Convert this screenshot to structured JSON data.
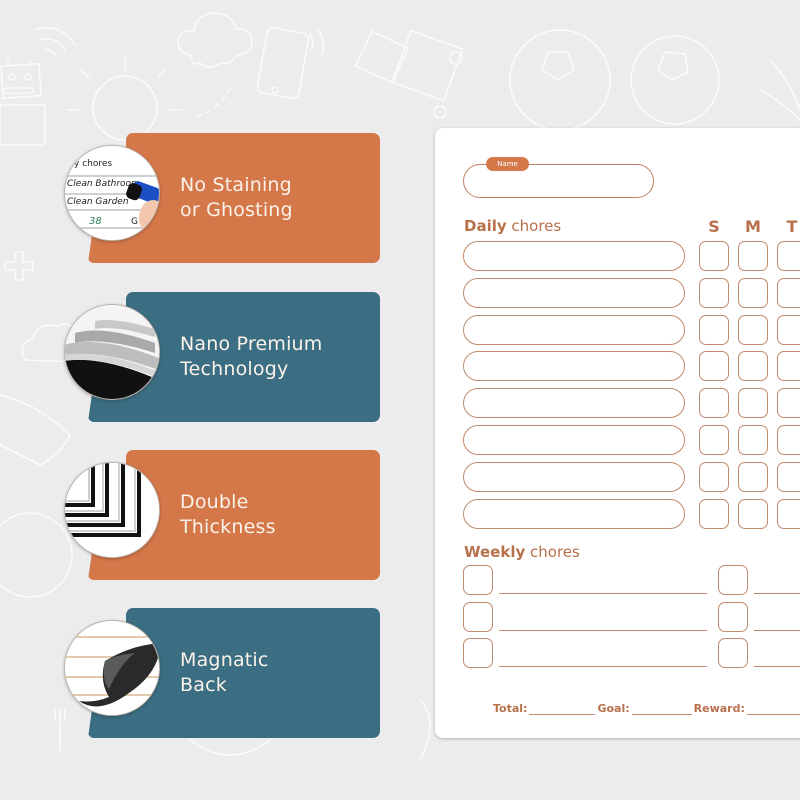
{
  "features": [
    {
      "line1": "No Staining",
      "line2": "or Ghosting",
      "theme": "orange",
      "image": "marker-whiteboard-image",
      "inset_text": {
        "heading": "ily chores",
        "item1": "Clean Bathroom",
        "item2": "Clean Garden",
        "number": "38",
        "trailing": "G"
      }
    },
    {
      "line1": "Nano Premium",
      "line2": "Technology",
      "theme": "teal",
      "image": "layered-film-image"
    },
    {
      "line1": "Double",
      "line2": "Thickness",
      "theme": "orange",
      "image": "stacked-boards-image"
    },
    {
      "line1": "Magnatic",
      "line2": "Back",
      "theme": "teal",
      "image": "magnetic-corner-peel-image"
    }
  ],
  "colors": {
    "orange": "#d4784a",
    "teal": "#3b6e82",
    "chart_brown": "#b8704a",
    "background": "#ececec"
  },
  "chart": {
    "name_label": "Name",
    "daily": {
      "bold": "Daily",
      "rest": " chores"
    },
    "days": [
      "S",
      "M",
      "T"
    ],
    "daily_rows": 8,
    "weekly": {
      "bold": "Weekly",
      "rest": " chores"
    },
    "weekly_rows": 3,
    "footer": {
      "total": "Total:",
      "goal": "Goal:",
      "reward": "Reward:"
    }
  }
}
